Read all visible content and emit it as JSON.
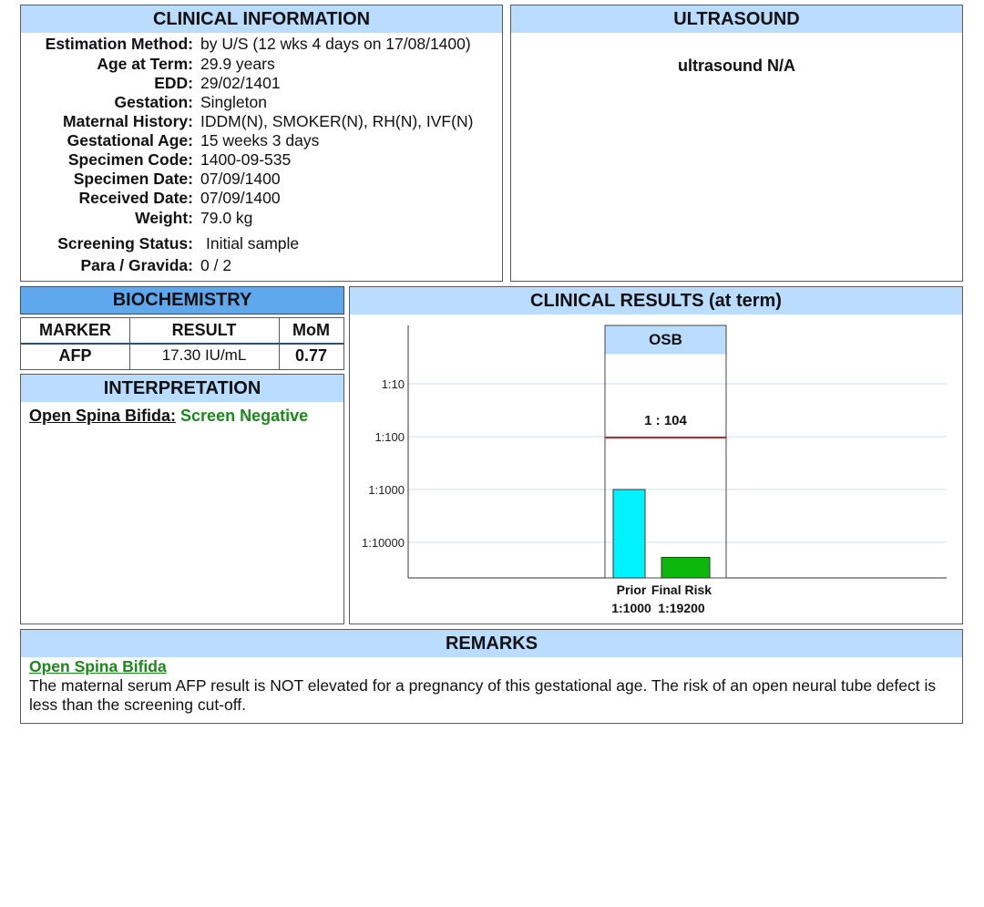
{
  "clinical_information": {
    "title": "CLINICAL INFORMATION",
    "rows": [
      {
        "label": "Estimation Method:",
        "value": "by U/S (12 wks 4 days on 17/08/1400)"
      },
      {
        "label": "Age at Term:",
        "value": "29.9 years"
      },
      {
        "label": "EDD:",
        "value": "29/02/1401"
      },
      {
        "label": "Gestation:",
        "value": "Singleton"
      },
      {
        "label": "Maternal History:",
        "value": "IDDM(N), SMOKER(N), RH(N), IVF(N)"
      },
      {
        "label": "Gestational Age:",
        "value": "15 weeks 3 days"
      },
      {
        "label": "Specimen Code:",
        "value": "1400-09-535"
      },
      {
        "label": "Specimen Date:",
        "value": "07/09/1400"
      },
      {
        "label": "Received Date:",
        "value": "07/09/1400"
      },
      {
        "label": "Weight:",
        "value": "79.0 kg"
      }
    ],
    "screening_status_label": "Screening Status:",
    "screening_status_value": "Initial sample",
    "para_gravida_label": "Para / Gravida:",
    "para_gravida_value": "0 / 2"
  },
  "ultrasound": {
    "title": "ULTRASOUND",
    "text": "ultrasound N/A"
  },
  "biochemistry": {
    "title": "BIOCHEMISTRY",
    "headers": [
      "MARKER",
      "RESULT",
      "MoM"
    ],
    "row": [
      "AFP",
      "17.30 IU/mL",
      "0.77"
    ]
  },
  "interpretation": {
    "title": "INTERPRETATION",
    "label": "Open Spina Bifida:",
    "result": "Screen Negative",
    "result_color": "#1a8a1a"
  },
  "clinical_results": {
    "title": "CLINICAL RESULTS (at term)"
  },
  "chart_data": {
    "type": "bar",
    "scale": "log-reciprocal",
    "y_ticks": [
      "1:10",
      "1:100",
      "1:1000",
      "1:10000"
    ],
    "group_label": "OSB",
    "cutoff_label": "1 : 104",
    "cutoff_value": 104,
    "cutoff_color": "#c0282a",
    "categories": [
      "Prior",
      "Final Risk"
    ],
    "values": [
      1000,
      19200
    ],
    "value_labels": [
      "1:1000",
      "1:19200"
    ],
    "colors": [
      "#00f3ff",
      "#0cb80c"
    ]
  },
  "remarks": {
    "title": "REMARKS",
    "heading": "Open Spina Bifida",
    "text": "The maternal serum AFP result is NOT elevated for a pregnancy of this gestational age.  The risk of an open neural tube defect is less than the screening cut-off."
  }
}
